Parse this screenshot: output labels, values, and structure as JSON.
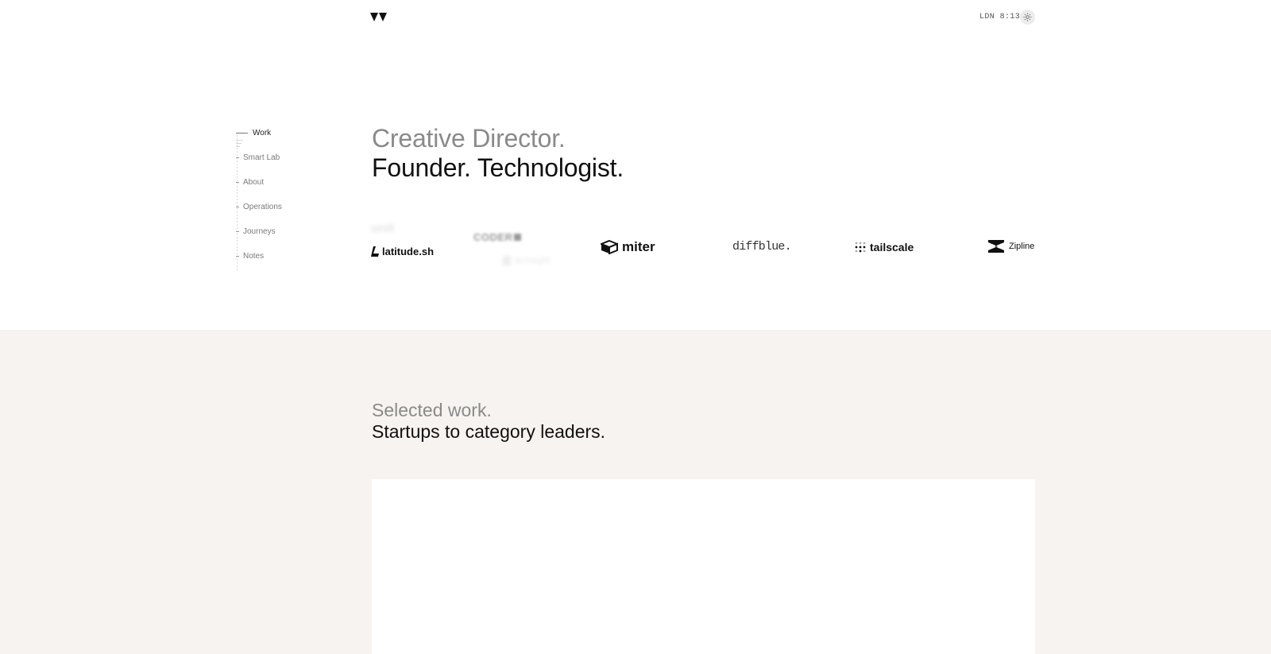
{
  "header": {
    "logo_icon": "double-triangle-logo-icon",
    "clock_label": "LDN 8:13",
    "theme_toggle_icon": "sun-icon"
  },
  "nav": {
    "items": [
      {
        "label": "Work",
        "active": true
      },
      {
        "label": "Smart Lab",
        "active": false
      },
      {
        "label": "About",
        "active": false
      },
      {
        "label": "Operations",
        "active": false
      },
      {
        "label": "Journeys",
        "active": false
      },
      {
        "label": "Notes",
        "active": false
      }
    ]
  },
  "hero": {
    "line1": "Creative Director.",
    "line2": "Founder. Technologist."
  },
  "clients": {
    "unit": "unit",
    "coder": "CODER",
    "latitude": "latitude.sh",
    "techsight": "techsight",
    "miter": "miter",
    "diffblue": "diffblue.",
    "tailscale": "tailscale",
    "zipline": "Zipline"
  },
  "work": {
    "line1": "Selected work.",
    "line2": "Startups to category leaders."
  },
  "colors": {
    "section_bg": "#f6f3f0",
    "muted_text": "#8a8a8a",
    "primary_text": "#111111"
  }
}
